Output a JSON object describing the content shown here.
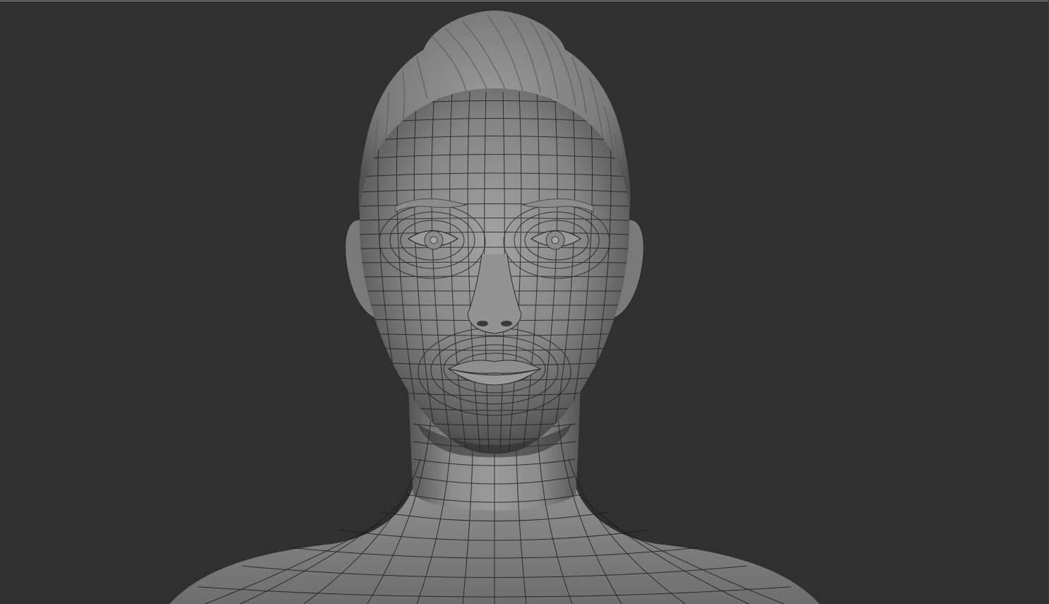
{
  "viewport": {
    "background_color": "#303030",
    "model_color": "#8a8a8a",
    "wireframe_color": "#1a1a1a",
    "subject": "sculpted-head-model"
  }
}
